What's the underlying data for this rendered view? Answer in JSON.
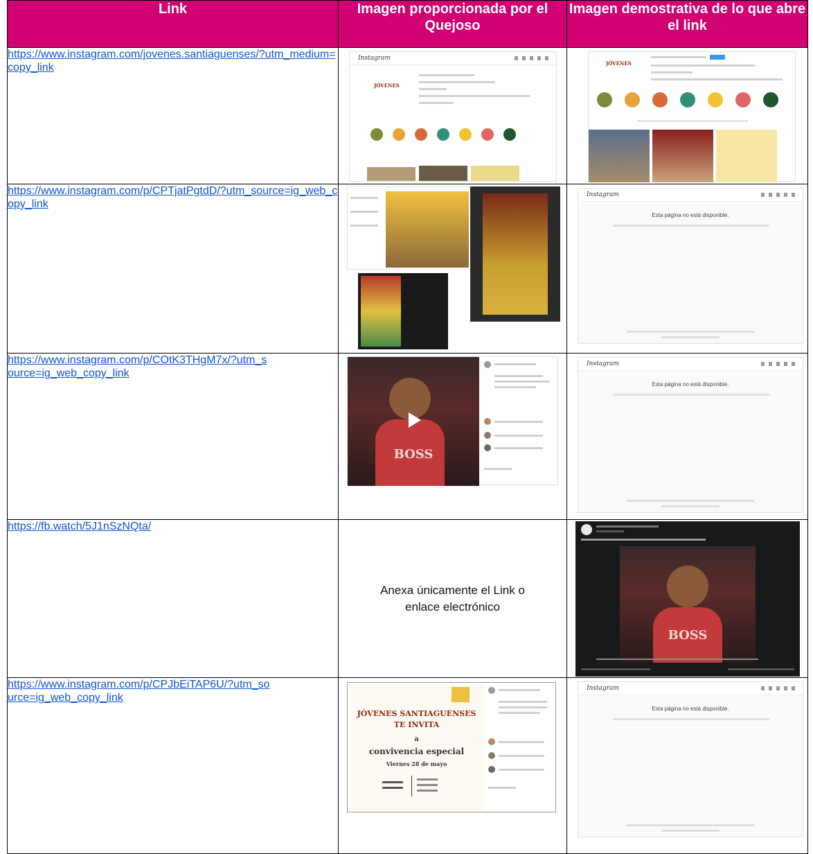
{
  "headers": {
    "col1": "Link",
    "col2": "Imagen proporcionada por el Quejoso",
    "col3": "Imagen demostrativa de lo que abre el link"
  },
  "rows": [
    {
      "link": "https://www.instagram.com/jovenes.santiaguenses/?utm_medium=copy_link"
    },
    {
      "link": "https://www.instagram.com/p/CPTjatPgtdD/?utm_source=ig_web_copy_link"
    },
    {
      "link": "https://www.instagram.com/p/COtK3THgM7x/?utm_source=ig_web_copy_link"
    },
    {
      "link": "https://fb.watch/5J1nSzNQta/",
      "provided_text": "Anexa únicamente el Link o enlace electrónico"
    },
    {
      "link": "https://www.instagram.com/p/CPJbEiTAP6U/?utm_source=ig_web_copy_link"
    }
  ],
  "screens": {
    "instagram_logo": "Instagram",
    "unavailable_title": "Esta página no está disponible.",
    "poster_line1": "JÓVENES SANTIAGUENSES",
    "poster_line2": "TE INVITA",
    "poster_line3": "a",
    "poster_line4": "convivencia especial",
    "poster_line5": "Viernes 28 de mayo",
    "shirt_text": "BOSS",
    "brand_tag": "JÓVENES"
  },
  "colors": {
    "header_bg": "#d10073",
    "link": "#1155cc",
    "story_circles": [
      "#7a8c3a",
      "#e8a33a",
      "#d9683a",
      "#2f8f7a",
      "#f1c232",
      "#e06666",
      "#1e5631"
    ]
  },
  "icons": [
    "play-icon",
    "instagram-logo-icon",
    "avatar-icon"
  ]
}
